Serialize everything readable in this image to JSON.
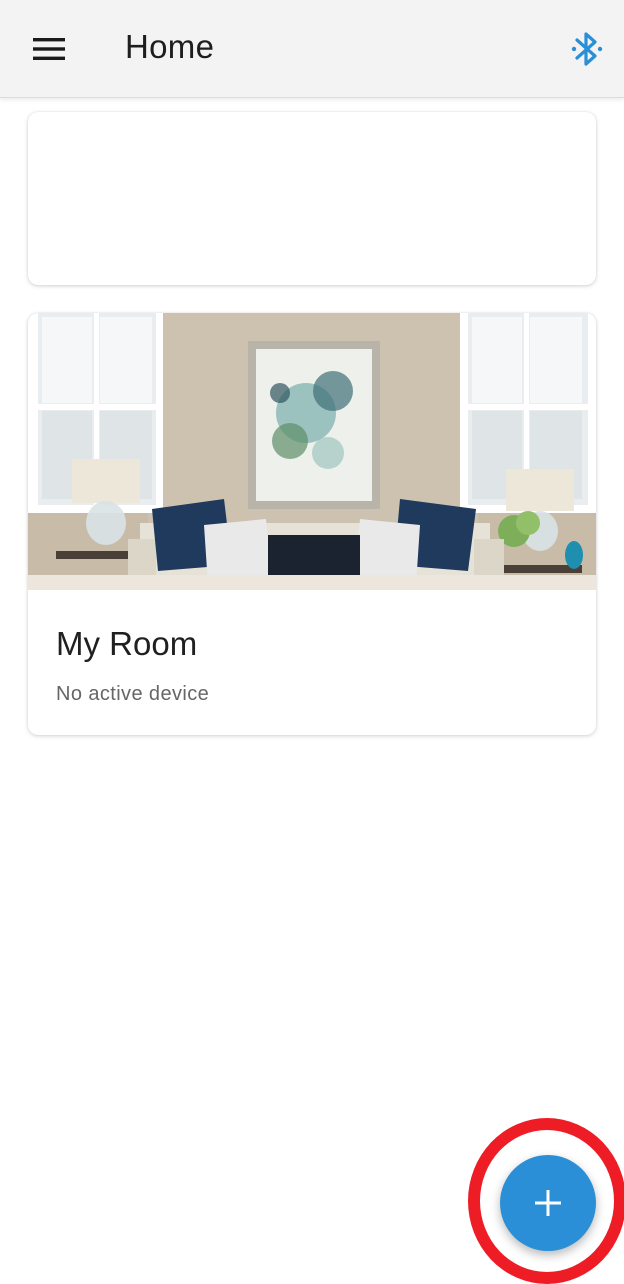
{
  "app_bar": {
    "title": "Home",
    "menu_icon": "hamburger-menu-icon",
    "bluetooth_icon": "bluetooth-icon",
    "accent_color": "#2a8fd6"
  },
  "rooms": [
    {
      "name": "My Room",
      "status": "No active device",
      "image": "living-room-photo"
    }
  ],
  "fab": {
    "icon": "plus-icon",
    "color": "#2a8fd6",
    "highlight_color": "#ee1c24"
  }
}
